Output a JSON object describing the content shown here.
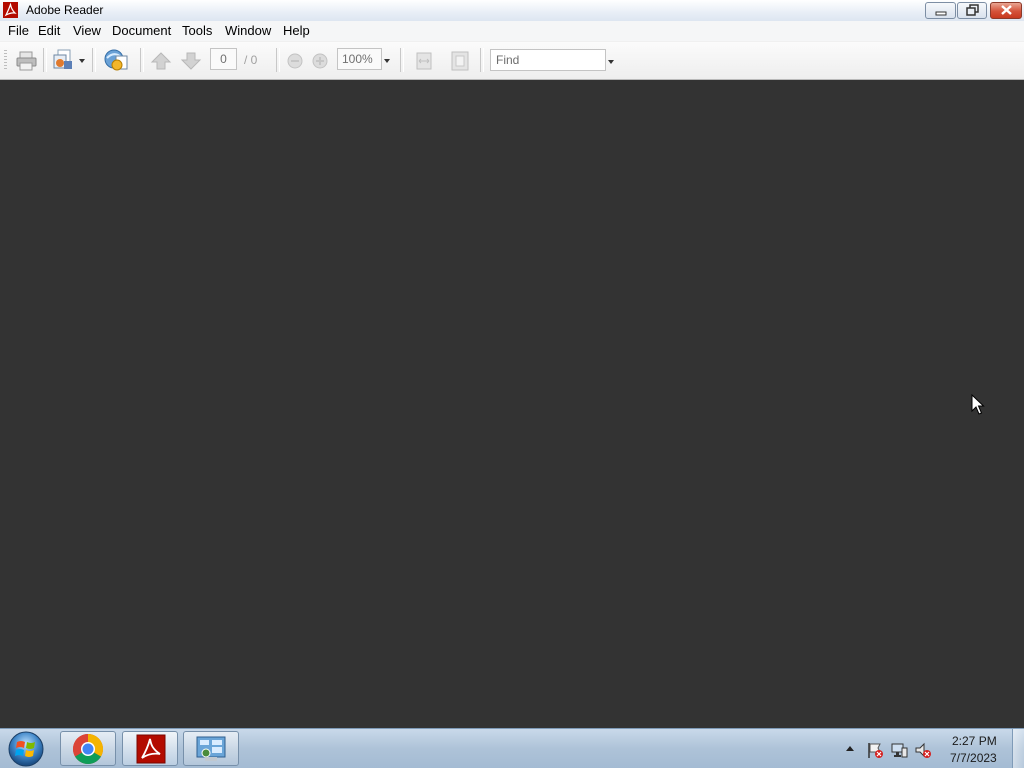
{
  "window": {
    "title": "Adobe Reader"
  },
  "menu": {
    "items": [
      "File",
      "Edit",
      "View",
      "Document",
      "Tools",
      "Window",
      "Help"
    ]
  },
  "toolbar": {
    "page_current": "0",
    "page_total": "/ 0",
    "zoom": "100%",
    "find_placeholder": "Find"
  },
  "taskbar": {
    "apps": [
      "chrome-icon",
      "adobe-reader-icon",
      "control-panel-icon"
    ],
    "time": "2:27 PM",
    "date": "7/7/2023"
  },
  "colors": {
    "document_background": "#333333",
    "adobe_red": "#b30b00",
    "close_button": "#c8391f"
  }
}
